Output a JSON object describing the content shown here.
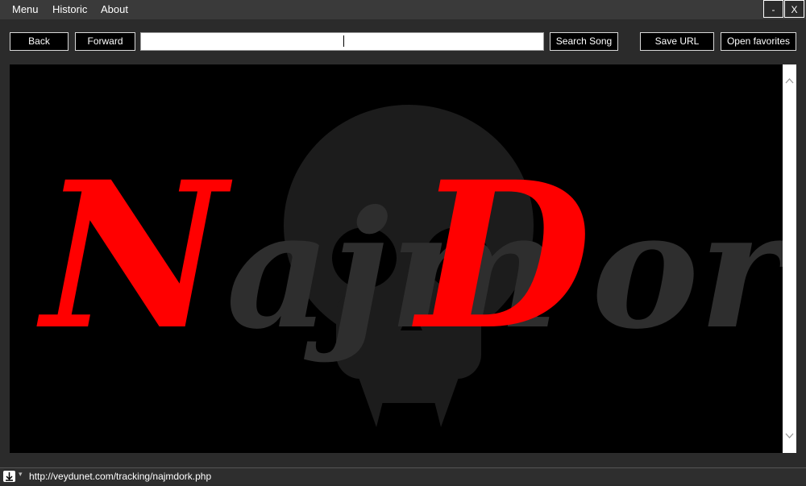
{
  "menu": {
    "items": [
      "Menu",
      "Historic",
      "About"
    ]
  },
  "window": {
    "minimize_label": "-",
    "close_label": "X"
  },
  "toolbar": {
    "back_label": "Back",
    "forward_label": "Forward",
    "url_value": "",
    "search_label": "Search Song",
    "save_label": "Save URL",
    "favorites_label": "Open favorites"
  },
  "page": {
    "logo_first": "Najm",
    "logo_second": "Dork",
    "logo_first_initial_color": "#ff0000",
    "logo_second_initial_color": "#ff0000",
    "logo_rest_color": "#2e2e2e"
  },
  "status": {
    "url": "http://veydunet.com/tracking/najmdork.php",
    "download_icon": "download-arrow-icon"
  }
}
